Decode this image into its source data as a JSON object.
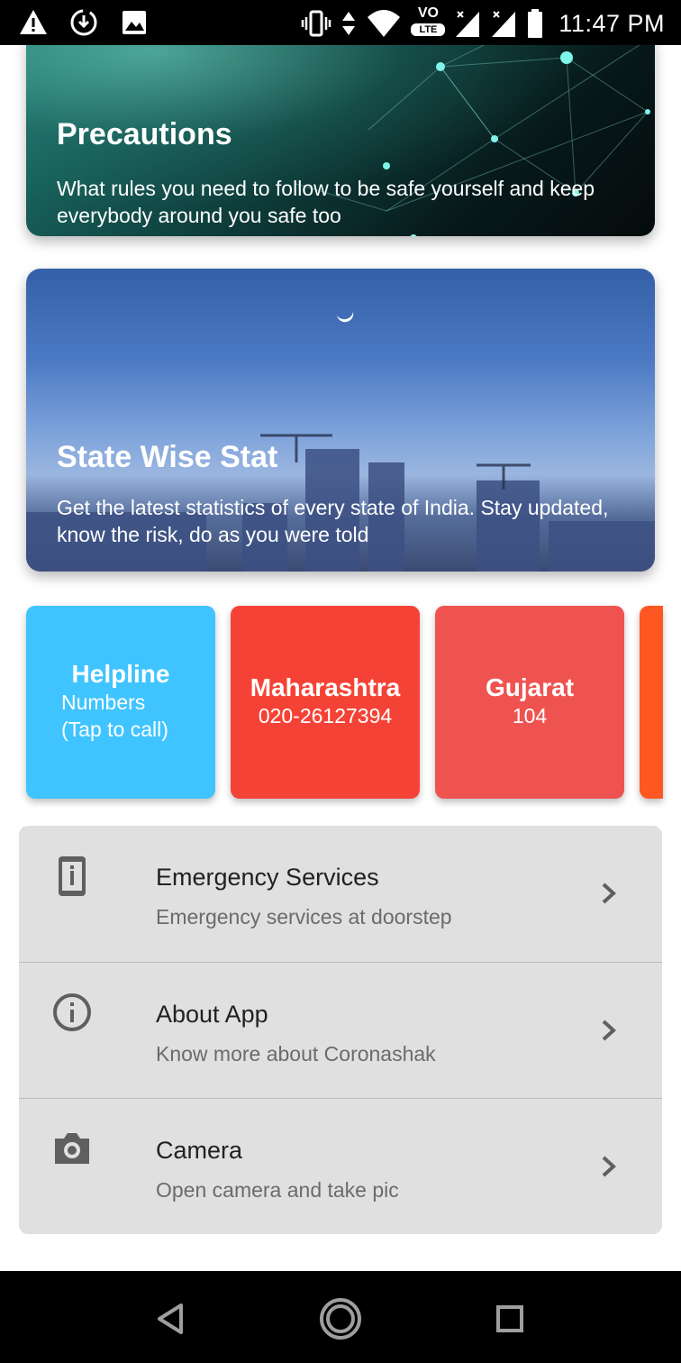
{
  "status_bar": {
    "time": "11:47 PM",
    "network_badge_top": "VO",
    "network_badge_bottom": "LTE",
    "left_icons": [
      "warning-icon",
      "download-icon",
      "image-icon"
    ],
    "right_icons": [
      "vibrate-icon",
      "data-arrows-icon",
      "wifi-icon",
      "volte-icon",
      "signal-icon",
      "signal-icon",
      "battery-icon"
    ]
  },
  "cards": [
    {
      "title": "Precautions",
      "description": "What rules you need to follow to be safe yourself and keep everybody around you safe too"
    },
    {
      "title": "State Wise Stat",
      "description": "Get the latest statistics of every state of India. Stay updated, know the risk, do as you were told"
    }
  ],
  "helpline": {
    "title": "Helpline",
    "line1": "Numbers",
    "line2": "(Tap to call)",
    "color": "#40c4ff"
  },
  "states": [
    {
      "name": "Maharashtra",
      "number": "020-26127394",
      "color": "#f44336"
    },
    {
      "name": "Gujarat",
      "number": "104",
      "color": "#ef5350"
    }
  ],
  "menu": [
    {
      "title": "Emergency Services",
      "subtitle": "Emergency services at doorstep",
      "icon": "phone-device-icon"
    },
    {
      "title": "About App",
      "subtitle": "Know more about Coronashak",
      "icon": "info-icon"
    },
    {
      "title": "Camera",
      "subtitle": "Open camera and take pic",
      "icon": "camera-icon"
    }
  ],
  "nav": [
    "back-icon",
    "home-icon",
    "recents-icon"
  ]
}
